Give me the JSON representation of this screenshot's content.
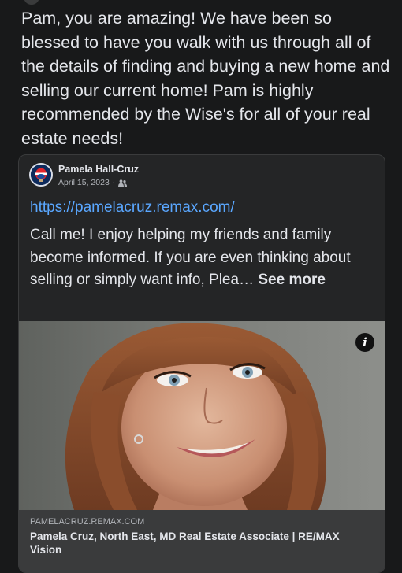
{
  "review": {
    "text": "Pam, you are amazing! We have been so blessed to have you walk with us through all of the details of finding and buying a new home and selling our current home!  Pam is highly recommended by the Wise's for all of your real estate needs!"
  },
  "shared_post": {
    "author_name": "Pamela Hall-Cruz",
    "date": "April 15, 2023",
    "meta_separator": " · ",
    "audience_icon": "friends-icon",
    "link_url": "https://pamelacruz.remax.com/",
    "body_text": "Call me!  I enjoy helping my friends and family become informed. If you are even thinking about selling or simply want info, Plea…",
    "see_more_label": "See more"
  },
  "link_preview": {
    "domain": "PAMELACRUZ.REMAX.COM",
    "title": "Pamela Cruz, North East, MD Real Estate Associate | RE/MAX Vision",
    "info_label": "i"
  },
  "colors": {
    "background": "#18191a",
    "card": "#242526",
    "link": "#5aa7ff",
    "footer": "#3a3b3c"
  }
}
